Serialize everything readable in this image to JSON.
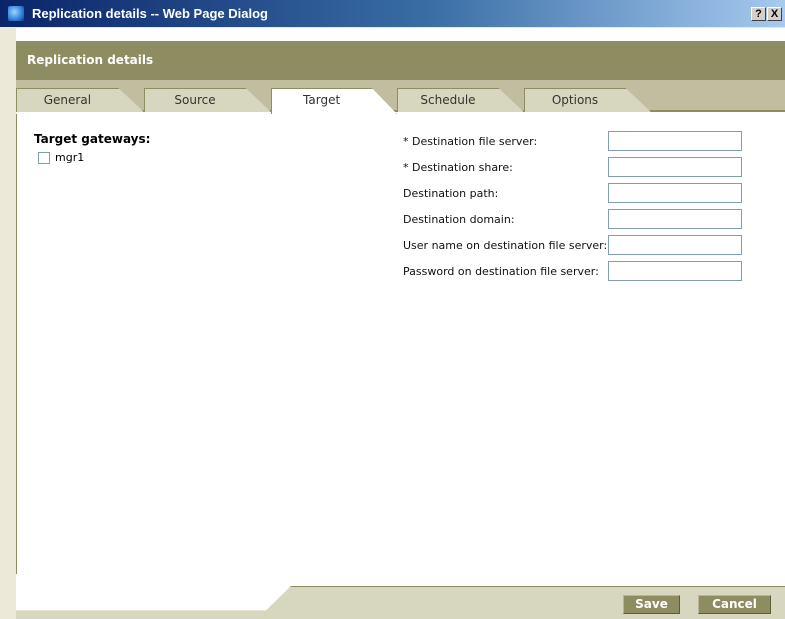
{
  "window": {
    "title": "Replication details -- Web Page Dialog",
    "help_label": "?",
    "close_label": "X"
  },
  "header": {
    "title": "Replication details"
  },
  "tabs": [
    {
      "label": "General",
      "active": false
    },
    {
      "label": "Source",
      "active": false
    },
    {
      "label": "Target",
      "active": true
    },
    {
      "label": "Schedule",
      "active": false
    },
    {
      "label": "Options",
      "active": false
    }
  ],
  "target_gateways": {
    "heading": "Target gateways:",
    "items": [
      {
        "label": "mgr1",
        "checked": false
      }
    ]
  },
  "form": {
    "fields": [
      {
        "label": "* Destination file server:",
        "value": ""
      },
      {
        "label": "* Destination share:",
        "value": ""
      },
      {
        "label": "Destination path:",
        "value": ""
      },
      {
        "label": "Destination domain:",
        "value": ""
      },
      {
        "label": "User name on destination file server:",
        "value": ""
      },
      {
        "label": "Password on destination file server:",
        "value": ""
      }
    ]
  },
  "footer": {
    "save_label": "Save",
    "cancel_label": "Cancel"
  },
  "colors": {
    "title_gradient_start": "#0a246a",
    "header_band": "#8e8c61",
    "tab_strip": "#c0be9e",
    "tab_inactive": "#d7d6bf",
    "dialog_bg": "#ece9d8"
  }
}
